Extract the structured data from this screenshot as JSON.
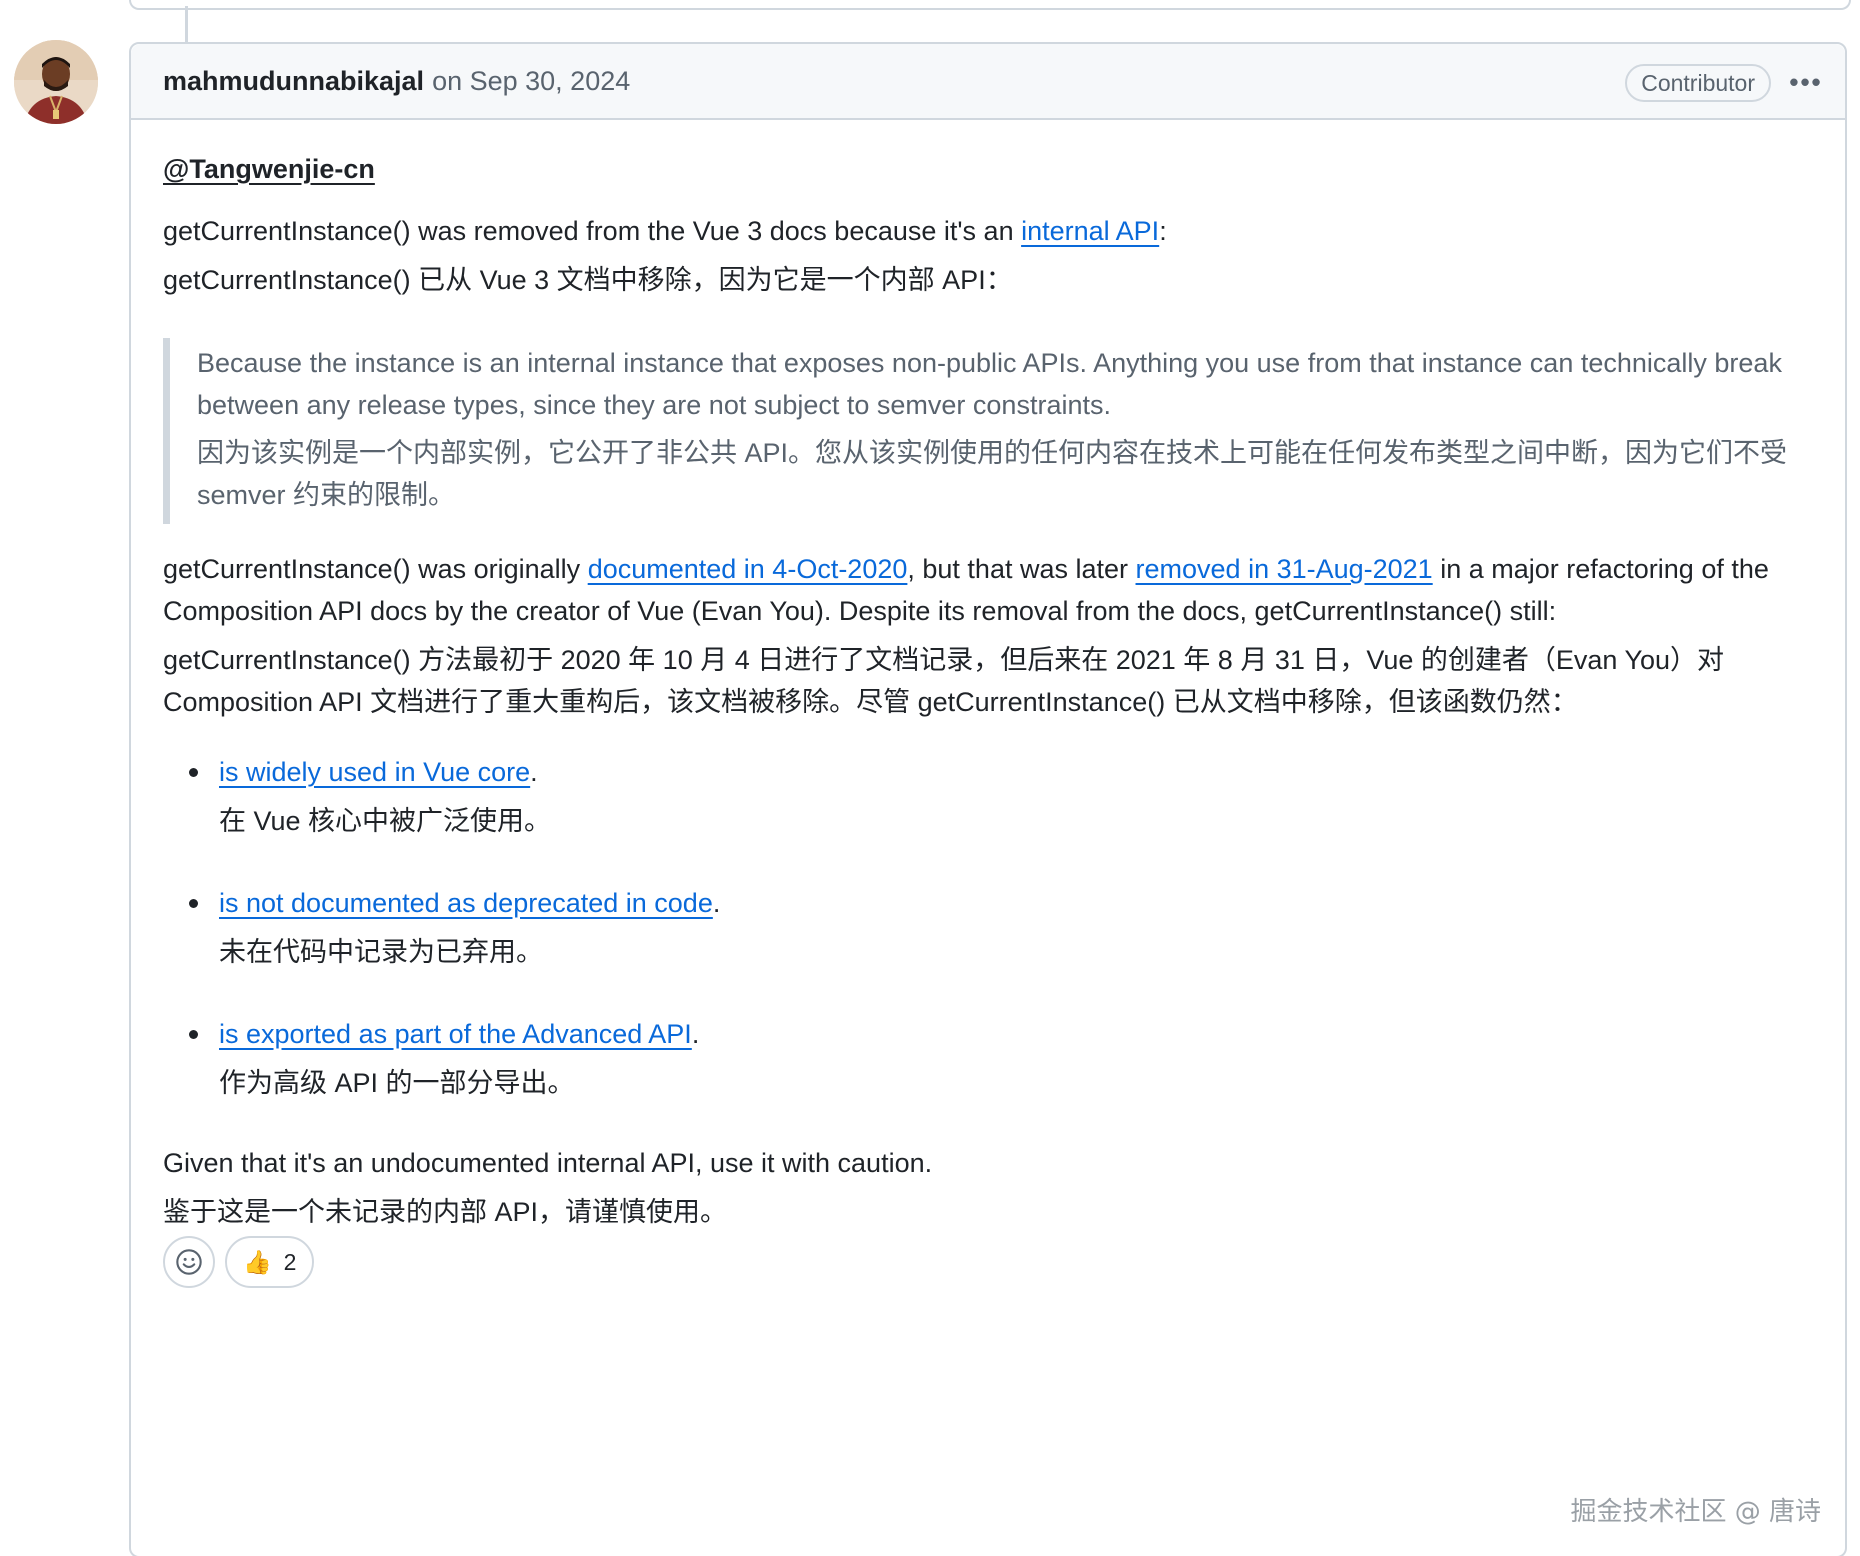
{
  "comment": {
    "author": "mahmudunnabikajal",
    "timestamp_text": "on Sep 30, 2024",
    "role_badge": "Contributor",
    "more_label": "•••",
    "mention": "@Tangwenjie-cn",
    "p1_pre": "getCurrentInstance() was removed from the Vue 3 docs because it's an ",
    "p1_link": "internal API",
    "p1_post": ":",
    "p1_zh": "getCurrentInstance() 已从 Vue 3 文档中移除，因为它是一个内部 API：",
    "quote_en": "Because the instance is an internal instance that exposes non-public APIs. Anything you use from that instance can technically break between any release types, since they are not subject to semver constraints.",
    "quote_zh": "因为该实例是一个内部实例，它公开了非公共 API。您从该实例使用的任何内容在技术上可能在任何发布类型之间中断，因为它们不受 semver 约束的限制。",
    "p2_a": "getCurrentInstance() was originally ",
    "p2_link1": "documented in 4-Oct-2020",
    "p2_b": ", but that was later ",
    "p2_link2": "removed in 31-Aug-2021",
    "p2_c": " in a major refactoring of the Composition API docs by the creator of Vue (Evan You). Despite its removal from the docs, getCurrentInstance() still:",
    "p2_zh": "getCurrentInstance() 方法最初于 2020 年 10 月 4 日进行了文档记录，但后来在 2021 年 8 月 31 日，Vue 的创建者（Evan You）对 Composition API 文档进行了重大重构后，该文档被移除。尽管 getCurrentInstance() 已从文档中移除，但该函数仍然：",
    "list": [
      {
        "link": "is widely used in Vue core",
        "punct": ".",
        "zh": "在 Vue 核心中被广泛使用。"
      },
      {
        "link": "is not documented as deprecated in code",
        "punct": ".",
        "zh": "未在代码中记录为已弃用。"
      },
      {
        "link": "is exported as part of the Advanced API",
        "punct": ".",
        "zh": "作为高级 API 的一部分导出。"
      }
    ],
    "closing_en": "Given that it's an undocumented internal API, use it with caution.",
    "closing_zh": "鉴于这是一个未记录的内部 API，请谨慎使用。",
    "reactions": {
      "picker_icon": "smiley-icon",
      "thumbs_emoji": "👍",
      "thumbs_count": "2"
    }
  },
  "watermark": "掘金技术社区 @ 唐诗",
  "colors": {
    "link": "#0969da",
    "border": "#d0d7de",
    "muted": "#59636e",
    "text": "#1f2328",
    "header_bg": "#f6f8fa"
  }
}
